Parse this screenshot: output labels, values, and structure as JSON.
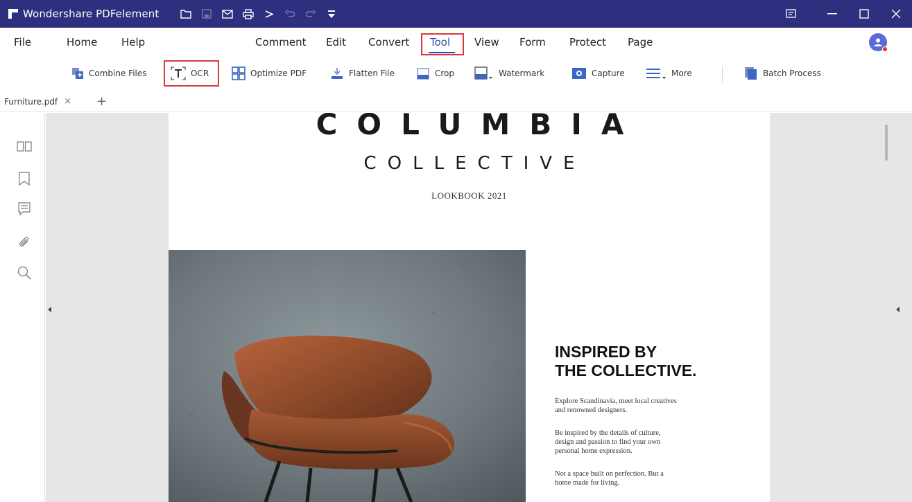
{
  "app": {
    "title": "Wondershare PDFelement"
  },
  "quick_access": [
    "folder-icon",
    "save-icon",
    "mail-icon",
    "print-icon",
    "share-icon",
    "undo-icon",
    "redo-icon",
    "customize-icon"
  ],
  "window_controls": [
    "feedback-icon",
    "minimize-icon",
    "maximize-icon",
    "close-icon"
  ],
  "menu": {
    "file": "File",
    "home": "Home",
    "help": "Help",
    "comment": "Comment",
    "edit": "Edit",
    "convert": "Convert",
    "tool": "Tool",
    "view": "View",
    "form": "Form",
    "protect": "Protect",
    "page": "Page",
    "active": "Tool"
  },
  "ribbon": {
    "combine_files": "Combine Files",
    "ocr": "OCR",
    "optimize_pdf": "Optimize PDF",
    "flatten_file": "Flatten File",
    "crop": "Crop",
    "watermark": "Watermark",
    "capture": "Capture",
    "more": "More",
    "batch_process": "Batch Process"
  },
  "tabs": {
    "current": "Furniture.pdf",
    "close_symbol": "×",
    "new_symbol": "+"
  },
  "sidebar_icons": [
    "thumbnails-icon",
    "bookmark-icon",
    "comments-icon",
    "attachments-icon",
    "search-icon"
  ],
  "document": {
    "brand_line1": "COLUMBIA",
    "brand_line2": "COLLECTIVE",
    "subtitle": "LOOKBOOK 2021",
    "headline_line1": "INSPIRED BY",
    "headline_line2": "THE COLLECTIVE.",
    "para1_line1": "Explore Scandinavia, meet local creatives",
    "para1_line2": "and renowned designers.",
    "para2_line1": "Be inspired by the details of culture,",
    "para2_line2": "design and passion to find your own",
    "para2_line3": "personal home expression.",
    "para3_line1": "Not a space built on perfection. But a",
    "para3_line2": "home made for living."
  },
  "colors": {
    "titlebar": "#2e2f7e",
    "highlight_box": "#d9383a",
    "active_tab": "#3a4aa8",
    "canvas": "#e6e6e6"
  }
}
